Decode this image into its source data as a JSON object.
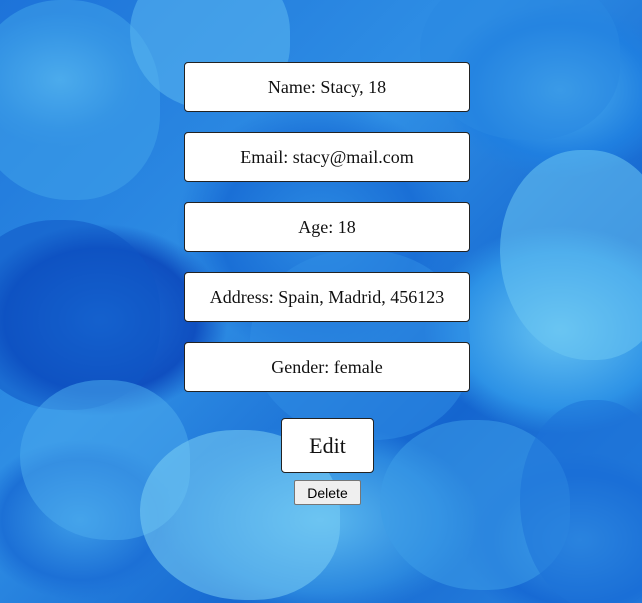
{
  "profile": {
    "name": "Name: Stacy, 18",
    "email": "Email: stacy@mail.com",
    "age": "Age: 18",
    "address": "Address: Spain, Madrid, 456123",
    "gender": "Gender: female"
  },
  "actions": {
    "edit_label": "Edit",
    "delete_label": "Delete"
  },
  "colors": {
    "background": "#1a73d8",
    "card_background": "#ffffff",
    "card_border": "#222222"
  }
}
